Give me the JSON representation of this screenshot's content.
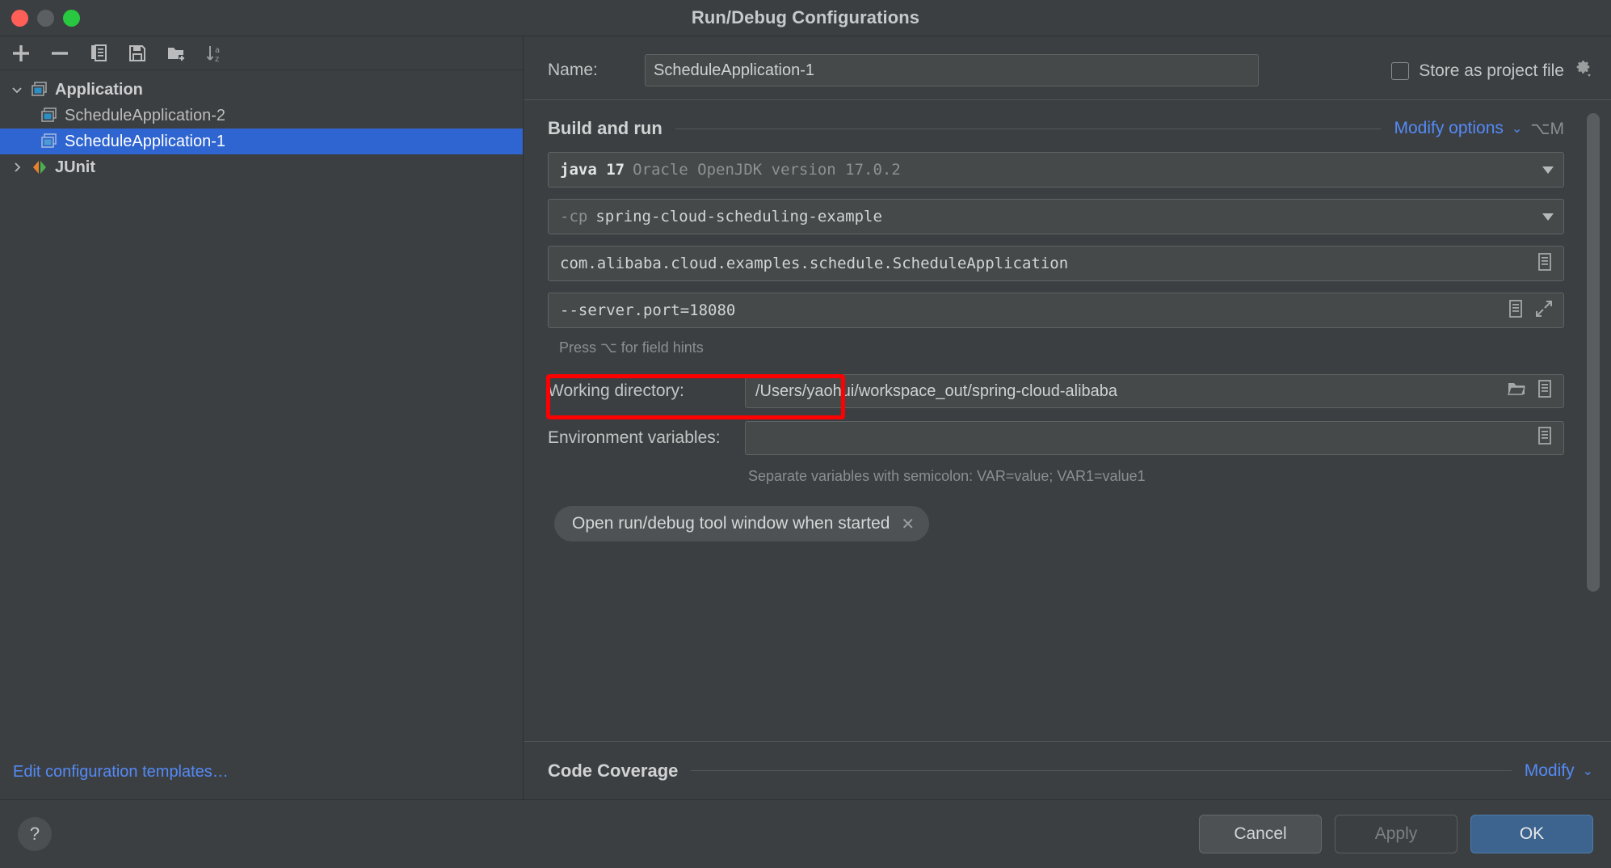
{
  "window": {
    "title": "Run/Debug Configurations",
    "traffic_lights": [
      "close",
      "minimize",
      "zoom"
    ]
  },
  "left_panel": {
    "toolbar": [
      {
        "name": "add-configuration-button",
        "icon": "plus-icon",
        "label": "+"
      },
      {
        "name": "remove-configuration-button",
        "icon": "minus-icon",
        "label": "−"
      },
      {
        "name": "copy-configuration-button",
        "icon": "copy-icon",
        "label": "Copy"
      },
      {
        "name": "save-configuration-button",
        "icon": "save-icon",
        "label": "Save"
      },
      {
        "name": "new-folder-button",
        "icon": "new-folder-icon",
        "label": "New Folder"
      },
      {
        "name": "sort-configurations-button",
        "icon": "sort-alphabetically-icon",
        "label": "Sort"
      }
    ],
    "tree": [
      {
        "label": "Application",
        "type": "group",
        "expanded": true,
        "selected": false,
        "icon": "application-icon",
        "depth": 0
      },
      {
        "label": "ScheduleApplication-2",
        "type": "item",
        "selected": false,
        "icon": "application-icon",
        "depth": 1
      },
      {
        "label": "ScheduleApplication-1",
        "type": "item",
        "selected": true,
        "icon": "application-icon",
        "depth": 1
      },
      {
        "label": "JUnit",
        "type": "group",
        "expanded": false,
        "selected": false,
        "icon": "junit-icon",
        "depth": 0
      }
    ],
    "edit_templates_link": "Edit configuration templates…"
  },
  "main": {
    "name_label": "Name:",
    "name_value": "ScheduleApplication-1",
    "store_as_project_file": {
      "label": "Store as project file",
      "checked": false,
      "gear_icon": "gear-icon"
    },
    "build_and_run": {
      "title": "Build and run",
      "modify_options_label": "Modify options",
      "modify_options_shortcut": "⌥M",
      "jre_field": {
        "name": "jre-selector",
        "prefix": "java 17",
        "suffix": "Oracle OpenJDK version 17.0.2"
      },
      "classpath_field": {
        "name": "classpath-selector",
        "prefix": "-cp",
        "value": "spring-cloud-scheduling-example"
      },
      "main_class_field": {
        "name": "main-class-input",
        "value": "com.alibaba.cloud.examples.schedule.ScheduleApplication"
      },
      "program_arguments_field": {
        "name": "program-arguments-input",
        "value": "--server.port=18080",
        "highlighted": true,
        "highlight_color": "#ff0000"
      },
      "field_hint": "Press ⌥ for field hints"
    },
    "working_directory": {
      "label": "Working directory:",
      "value": "/Users/yaohui/workspace_out/spring-cloud-alibaba"
    },
    "environment_variables": {
      "label": "Environment variables:",
      "value": "",
      "hint": "Separate variables with semicolon: VAR=value; VAR1=value1"
    },
    "option_chip": {
      "label": "Open run/debug tool window when started",
      "close_icon": "close-icon"
    },
    "code_coverage": {
      "title": "Code Coverage",
      "modify_label": "Modify"
    }
  },
  "footer": {
    "help_label": "?",
    "cancel_label": "Cancel",
    "apply_label": "Apply",
    "ok_label": "OK"
  },
  "colors": {
    "accent_link": "#548af7",
    "selection": "#2f65d0",
    "primary_button": "#3c648f",
    "annotation": "#ff0000",
    "window_bg": "#3c3f41"
  }
}
